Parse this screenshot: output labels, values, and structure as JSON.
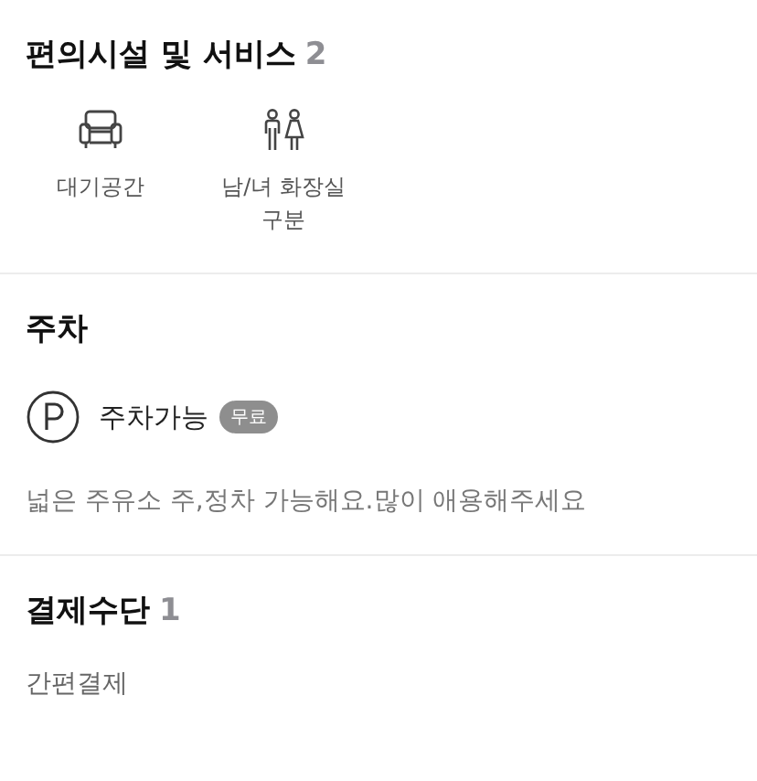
{
  "amenities": {
    "title": "편의시설 및 서비스",
    "count": "2",
    "items": [
      {
        "kind": "armchair",
        "label": "대기공간"
      },
      {
        "kind": "people",
        "label": "남/녀 화장실 구분"
      }
    ]
  },
  "parking": {
    "title": "주차",
    "status": "주차가능",
    "badge": "무료",
    "description": "넓은 주유소 주,정차 가능해요.많이 애용해주세요"
  },
  "payment": {
    "title": "결제수단",
    "count": "1",
    "methods": [
      "간편결제"
    ]
  }
}
